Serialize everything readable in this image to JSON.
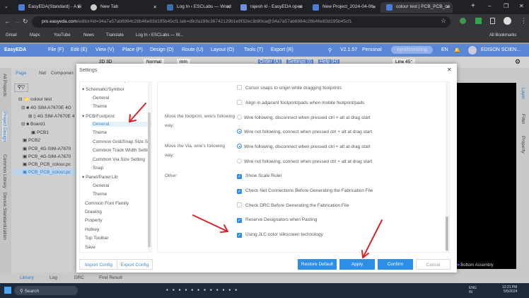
{
  "browser": {
    "tabs": [
      {
        "title": "EasyEDA(Standard) - A Si"
      },
      {
        "title": "New Tab"
      },
      {
        "title": "Log In ‹ ESCLabs — Word"
      },
      {
        "title": "rajesh kl - EasyEDA open"
      },
      {
        "title": "New Project_2024-04-06"
      },
      {
        "title": "colour test | PCB_PCB_co"
      }
    ],
    "url_host": "pro.easyeda.com",
    "url_rest": "/editor#id=34a7a57ab6984c28b46e83d195b45cf1,tab=d9cfa186c36742129b1e9f32ec3b90ca@34a7a57ab6984c28b46e83d195b45cf1",
    "bookmarks": [
      "Gmail",
      "Maps",
      "YouTube",
      "News",
      "Translate",
      "Log In ‹ ESCLabs — W..."
    ],
    "all_bookmarks": "All Bookmarks"
  },
  "app": {
    "logo": "EasyEDA",
    "menu": [
      "File (F)",
      "Edit (E)",
      "View (V)",
      "Place (P)",
      "Design (D)",
      "Route (U)",
      "Layout (O)",
      "Tools (T)",
      "Export (R)"
    ],
    "version": "V2.1.57",
    "plan": "Personal",
    "sync": "synchronizing",
    "lang": "EN",
    "user": "EDISON SCIEN...",
    "toolbar": {
      "mode": "Normal",
      "unit": "mm",
      "order": "Order (A)",
      "settings": "Settings (I)",
      "help": "Help (H)",
      "line": "Line 45°"
    },
    "left_tabs": [
      "Page",
      "Net",
      "Componen"
    ],
    "vertical_tabs": [
      "All Projects",
      "Project Design",
      "Common Library",
      "Device Standardization"
    ],
    "tree": [
      "colour test",
      "4G SIM-A7670E 4G",
      "4G SIM-A7670E 4",
      "Board1",
      "PCB1",
      "PCB2",
      "PCB_4G-SIM-A7670",
      "PCB_4G-SIM-A7670",
      "PCB_PCB_colour.pc",
      "PCB_PCB_colour.pc"
    ],
    "right_tabs": [
      "Layer",
      "Filter",
      "Property"
    ],
    "layer_legend": "Bottom Assembly",
    "bottom_tabs": [
      "Library",
      "Log",
      "DRC",
      "Find Result"
    ]
  },
  "settings": {
    "title": "Settings",
    "tree": [
      {
        "label": "Common Library",
        "level": 1
      },
      {
        "label": "Schematic/Symbol",
        "level": 0
      },
      {
        "label": "General",
        "level": 1
      },
      {
        "label": "Theme",
        "level": 1
      },
      {
        "label": "PCB/Footprint",
        "level": 0
      },
      {
        "label": "General",
        "level": 1,
        "selected": true
      },
      {
        "label": "Theme",
        "level": 1
      },
      {
        "label": "Common Grid/Snap Size Se",
        "level": 1
      },
      {
        "label": "Common Track Width Settir",
        "level": 1
      },
      {
        "label": "Common Via Size Setting",
        "level": 1
      },
      {
        "label": "Snap",
        "level": 1
      },
      {
        "label": "Panel/Panel Lib",
        "level": 0
      },
      {
        "label": "General",
        "level": 1
      },
      {
        "label": "Theme",
        "level": 1
      },
      {
        "label": "Common Font Family",
        "level": 2
      },
      {
        "label": "Drawing",
        "level": 2
      },
      {
        "label": "Property",
        "level": 2
      },
      {
        "label": "Hotkey",
        "level": 2
      },
      {
        "label": "Top Toolbar",
        "level": 2
      },
      {
        "label": "Save",
        "level": 2
      }
    ],
    "labels": {
      "footprint": "Move the footprint, wire's following way:",
      "via": "Move the Via, wire's following way:",
      "other": "Other:"
    },
    "options": [
      {
        "type": "checkbox",
        "checked": false,
        "label": "Cursor snaps to origin while dragging footprints"
      },
      {
        "type": "checkbox",
        "checked": false,
        "label": "Align in adjacent footprint/pads when mobile footprint/pads"
      },
      {
        "type": "radio",
        "checked": false,
        "label": "Wire following, disconnect when pressed ctrl + alt at drag start"
      },
      {
        "type": "radio",
        "checked": true,
        "label": "Wire not following, connect when pressed ctrl + alt at drag start"
      },
      {
        "type": "radio",
        "checked": true,
        "label": "Wire following, disconnect when pressed ctrl + alt at drag start"
      },
      {
        "type": "radio",
        "checked": false,
        "label": "Wire not following, connect when pressed ctrl + alt at drag start"
      },
      {
        "type": "checkbox",
        "checked": true,
        "label": "Show Scale Ruler"
      },
      {
        "type": "checkbox",
        "checked": true,
        "label": "Check Net Connections Before Generating the Fabrication File"
      },
      {
        "type": "checkbox",
        "checked": false,
        "label": "Check DRC Before Generating the Fabrication File"
      },
      {
        "type": "checkbox",
        "checked": true,
        "label": "Reserve Designators when Pasting"
      },
      {
        "type": "checkbox",
        "checked": true,
        "label": "Using JLC color silkscreen technology"
      }
    ],
    "buttons": {
      "import": "Import Config",
      "export": "Export Config",
      "restore": "Restore Default",
      "apply": "Apply",
      "confirm": "Confirm",
      "cancel": "Cancel"
    }
  },
  "taskbar": {
    "search": "Search",
    "lang": "ENG IN",
    "time": "12:21 PM",
    "date": "5/5/2024"
  },
  "colors": {
    "accent": "#2d8ee8",
    "menu": "#5a86d6",
    "arrow": "#d9232a"
  }
}
